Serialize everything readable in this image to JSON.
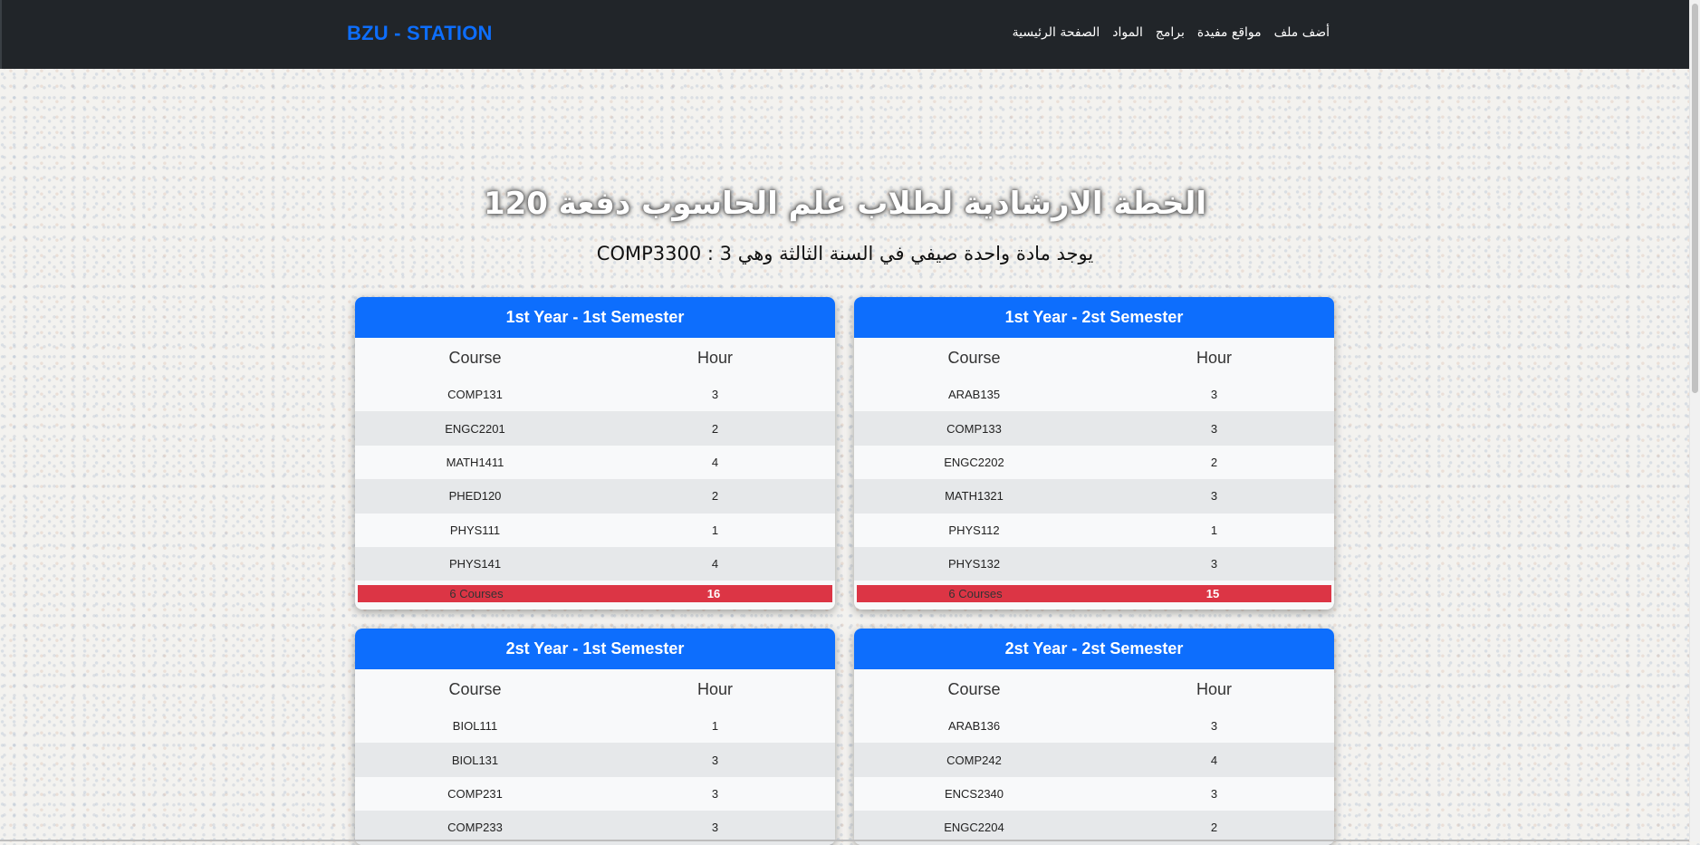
{
  "navbar": {
    "brand": "BZU - STATION",
    "links": [
      "أضف ملف",
      "مواقع مفيدة",
      "برامج",
      "المواد",
      "الصفحة الرئيسية"
    ]
  },
  "page": {
    "title": "الخطة الارشادية لطلاب علم الحاسوب دفعة 120",
    "subtitle": "يوجد مادة واحدة صيفي في السنة الثالثة وهي 3 : COMP3300"
  },
  "table_headers": {
    "course": "Course",
    "hour": "Hour"
  },
  "semesters": [
    {
      "title": "1st Year - 1st Semester",
      "courses": [
        {
          "code": "COMP131",
          "hours": "3"
        },
        {
          "code": "ENGC2201",
          "hours": "2"
        },
        {
          "code": "MATH1411",
          "hours": "4"
        },
        {
          "code": "PHED120",
          "hours": "2"
        },
        {
          "code": "PHYS111",
          "hours": "1"
        },
        {
          "code": "PHYS141",
          "hours": "4"
        }
      ],
      "total_label": "6 Courses",
      "total_hours": "16"
    },
    {
      "title": "1st Year - 2st Semester",
      "courses": [
        {
          "code": "ARAB135",
          "hours": "3"
        },
        {
          "code": "COMP133",
          "hours": "3"
        },
        {
          "code": "ENGC2202",
          "hours": "2"
        },
        {
          "code": "MATH1321",
          "hours": "3"
        },
        {
          "code": "PHYS112",
          "hours": "1"
        },
        {
          "code": "PHYS132",
          "hours": "3"
        }
      ],
      "total_label": "6 Courses",
      "total_hours": "15"
    },
    {
      "title": "2st Year - 1st Semester",
      "courses": [
        {
          "code": "BIOL111",
          "hours": "1"
        },
        {
          "code": "BIOL131",
          "hours": "3"
        },
        {
          "code": "COMP231",
          "hours": "3"
        },
        {
          "code": "COMP233",
          "hours": "3"
        }
      ]
    },
    {
      "title": "2st Year - 2st Semester",
      "courses": [
        {
          "code": "ARAB136",
          "hours": "3"
        },
        {
          "code": "COMP242",
          "hours": "4"
        },
        {
          "code": "ENCS2340",
          "hours": "3"
        },
        {
          "code": "ENGC2204",
          "hours": "2"
        }
      ]
    }
  ]
}
